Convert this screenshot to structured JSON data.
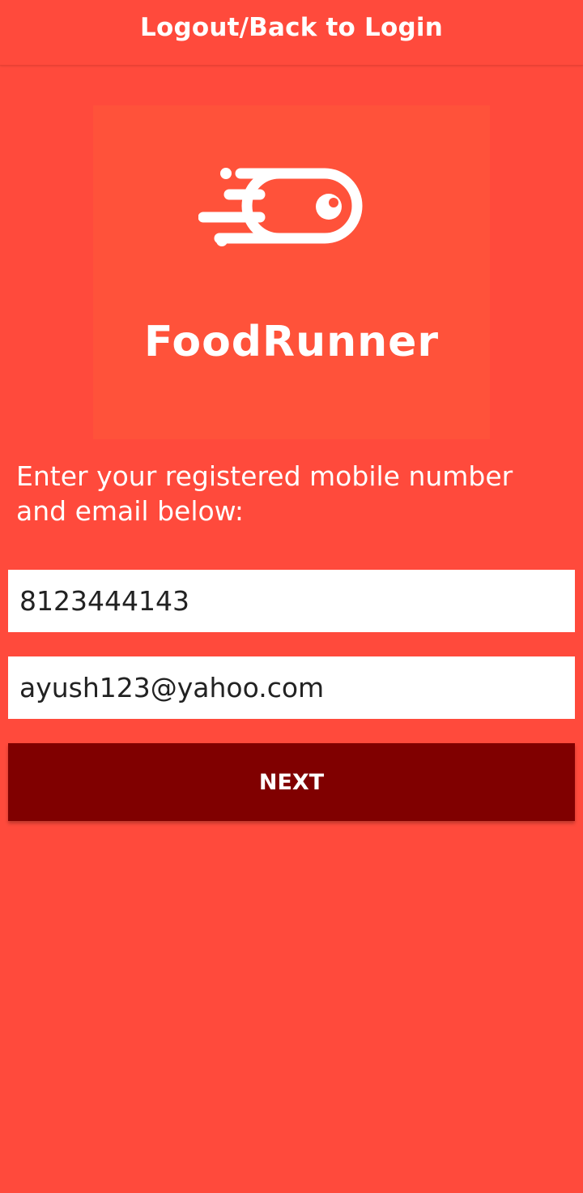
{
  "header": {
    "title": "Logout/Back to Login"
  },
  "logo": {
    "icon": "speeding-ball-icon",
    "text": "FoodRunner"
  },
  "form": {
    "instruction": "Enter your registered mobile number and email below:",
    "mobile_value": "8123444143",
    "email_value": "ayush123@yahoo.com",
    "next_label": "NEXT"
  },
  "colors": {
    "background": "#FF4A3C",
    "logo_background": "#FF523A",
    "button": "#800000",
    "text": "#FFFFFF"
  }
}
